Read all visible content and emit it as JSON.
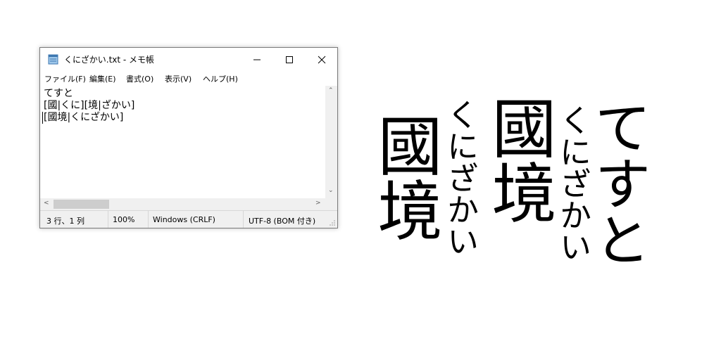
{
  "window": {
    "title": "くにざかい.txt - メモ帳",
    "controls": {
      "minimize": "─",
      "maximize": "☐",
      "close": "✕"
    }
  },
  "menu": {
    "file": "ファイル(F)",
    "edit": "編集(E)",
    "format": "書式(O)",
    "view": "表示(V)",
    "help": "ヘルプ(H)"
  },
  "editor": {
    "lines": [
      "てすと",
      "[國|くに][境|ざかい]",
      "[國境|くにざかい]"
    ]
  },
  "scroll": {
    "up": "⌃",
    "down": "⌄",
    "left": "<",
    "right": ">"
  },
  "status": {
    "position": "3 行、1 列",
    "zoom": "100%",
    "line_ending": "Windows (CRLF)",
    "encoding": "UTF-8 (BOM 付き)"
  },
  "vertical": {
    "col1": "てすと",
    "col2": {
      "base": "國境",
      "ruby": "くにざかい"
    },
    "col3": {
      "base": "國境",
      "ruby": "くにざかい"
    }
  }
}
